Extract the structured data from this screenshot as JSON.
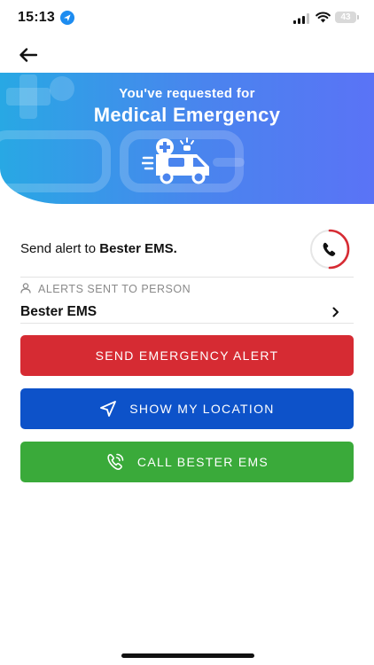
{
  "status_bar": {
    "time": "15:13",
    "battery": "43"
  },
  "header": {
    "back_icon": "arrow-left-icon"
  },
  "banner": {
    "subtitle": "You've requested for",
    "title": "Medical Emergency",
    "illustration": "ambulance-icon"
  },
  "alert": {
    "prefix": "Send alert to ",
    "recipient": "Bester EMS",
    "suffix": ".",
    "call_icon": "phone-icon"
  },
  "alerts_section": {
    "label": "ALERTS SENT TO PERSON",
    "person": "Bester EMS"
  },
  "buttons": {
    "send_alert": "SEND EMERGENCY ALERT",
    "show_location": "SHOW MY LOCATION",
    "call": "CALL BESTER EMS"
  },
  "colors": {
    "red": "#d62b33",
    "blue": "#0d52c9",
    "green": "#3aaa3a",
    "banner_start": "#28a8e4",
    "banner_end": "#5a73f6"
  }
}
